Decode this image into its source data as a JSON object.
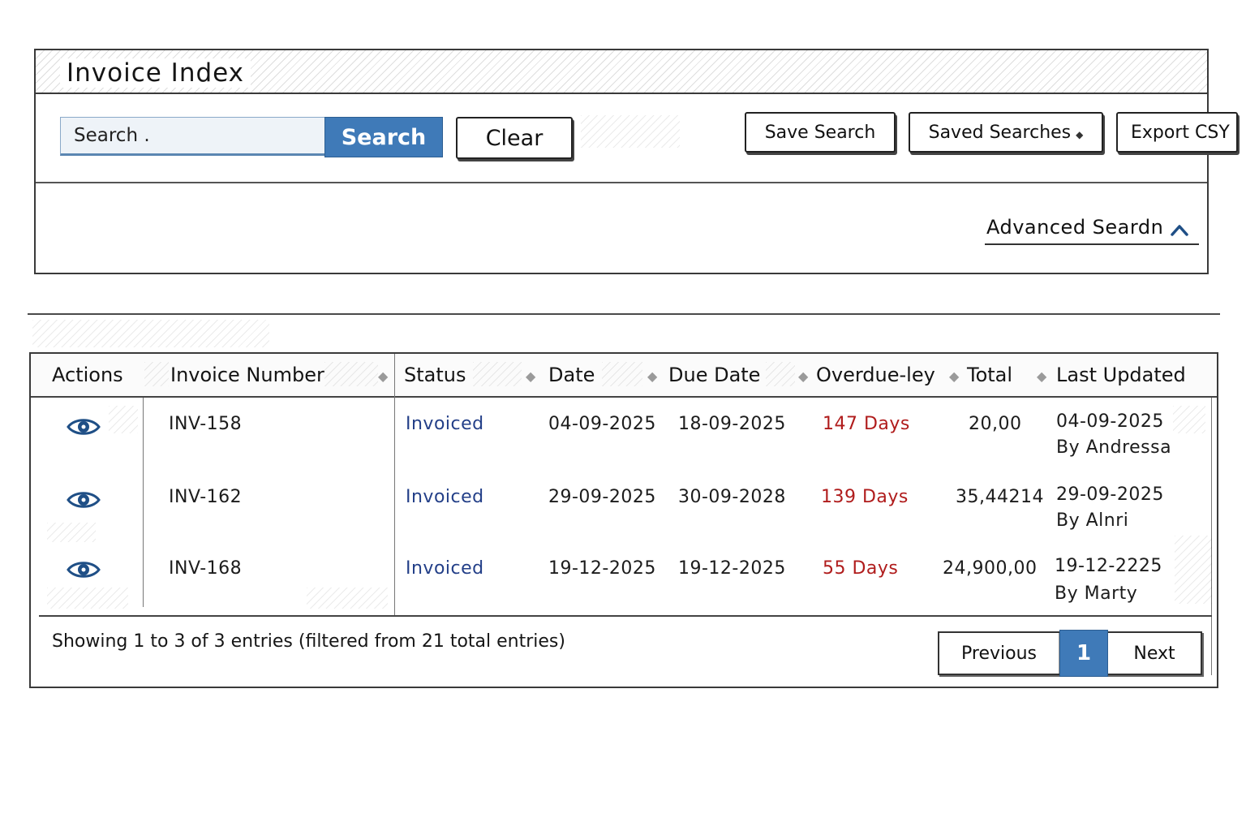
{
  "header": {
    "title": "Invoice Index"
  },
  "toolbar": {
    "search_placeholder": "Search .",
    "search_label": "Search",
    "clear_label": "Clear",
    "save_search_label": "Save Search",
    "saved_searches_label": "Saved Searches",
    "export_label": "Export CSY",
    "advanced_search_label": "Advanced Seardn"
  },
  "table": {
    "columns": [
      "Actions",
      "Invoice Number",
      "Status",
      "Date",
      "Due Date",
      "Overdue-ley",
      "Total",
      "Last Updated"
    ],
    "rows": [
      {
        "invoice": "INV-158",
        "status": "Invoiced",
        "date": "04-09-2025",
        "due_date": "18-09-2025",
        "overdue": "147 Days",
        "total": "20,00",
        "updated_date": "04-09-2025",
        "updated_by": "By Andressa"
      },
      {
        "invoice": "INV-162",
        "status": "Invoiced",
        "date": "29-09-2025",
        "due_date": "30-09-2028",
        "overdue": "139 Days",
        "total": "35,44214",
        "updated_date": "29-09-2025",
        "updated_by": "By Alnri"
      },
      {
        "invoice": "INV-168",
        "status": "Invoiced",
        "date": "19-12-2025",
        "due_date": "19-12-2025",
        "overdue": "55 Days",
        "total": "24,900,00",
        "updated_date": "19-12-2225",
        "updated_by": "By Marty"
      }
    ],
    "action_icon": "eye-icon",
    "sort_icon": "sort-diamond-icon"
  },
  "footer": {
    "info": "Showing 1 to 3 of 3 entries (filtered from 21 total entries)",
    "previous_label": "Previous",
    "current_page": "1",
    "next_label": "Next"
  },
  "colors": {
    "accent": "#3f7ab8",
    "status": "#233f88",
    "overdue": "#b01c1c",
    "eye_icon": "#1f4f86"
  }
}
